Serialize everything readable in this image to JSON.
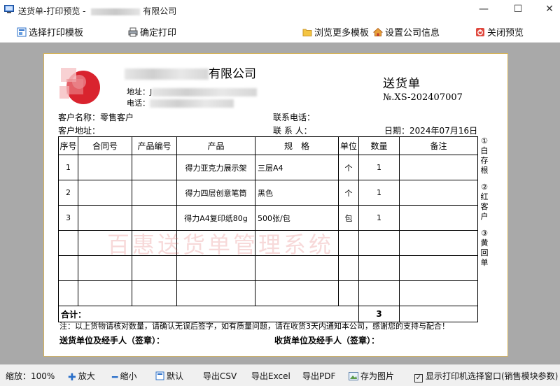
{
  "window": {
    "title_prefix": "送货单-打印预览 - ",
    "title_suffix": "有限公司",
    "minimize": "—",
    "maximize": "☐",
    "close": "✕"
  },
  "toolbar": {
    "select_template": "选择打印模板",
    "confirm_print": "确定打印",
    "browse_templates": "浏览更多模板",
    "company_info": "设置公司信息",
    "close_preview": "关闭预览"
  },
  "doc": {
    "company_suffix": "有限公司",
    "address_label": "地址：",
    "address_value": "J",
    "phone_label": "电话：",
    "title": "送货单",
    "number": "№.XS-202407007",
    "customer_name_label": "客户名称：",
    "customer_name": "零售客户",
    "customer_addr_label": "客户地址：",
    "contact_phone_label": "联系电话：",
    "contact_person_label": "联 系 人：",
    "date_label": "日期：",
    "date": "2024年07月16日",
    "headers": [
      "序号",
      "合同号",
      "产品编号",
      "产品",
      "规　格",
      "单位",
      "数量",
      "备注"
    ],
    "rows": [
      {
        "no": "1",
        "contract": "",
        "code": "",
        "product": "得力亚克力展示架",
        "spec": "三层A4",
        "unit": "个",
        "qty": "1",
        "remark": ""
      },
      {
        "no": "2",
        "contract": "",
        "code": "",
        "product": "得力四层创意笔筒",
        "spec": "黑色",
        "unit": "个",
        "qty": "1",
        "remark": ""
      },
      {
        "no": "3",
        "contract": "",
        "code": "",
        "product": "得力A4复印纸80g",
        "spec": "500张/包",
        "unit": "包",
        "qty": "1",
        "remark": ""
      },
      {
        "no": "",
        "contract": "",
        "code": "",
        "product": "",
        "spec": "",
        "unit": "",
        "qty": "",
        "remark": ""
      },
      {
        "no": "",
        "contract": "",
        "code": "",
        "product": "",
        "spec": "",
        "unit": "",
        "qty": "",
        "remark": ""
      },
      {
        "no": "",
        "contract": "",
        "code": "",
        "product": "",
        "spec": "",
        "unit": "",
        "qty": "",
        "remark": ""
      }
    ],
    "total_label": "合计：",
    "total_qty": "3",
    "copies": [
      "①",
      "白",
      "存",
      "根",
      "②",
      "红",
      "客",
      "户",
      "③",
      "黄",
      "回",
      "单"
    ],
    "watermark": "百惠送货单管理系统",
    "note": "注：以上货物请核对数量，请确认无误后签字，如有质量问题，请在收货3天内通知本公司，感谢您的支持与配合！",
    "sender_sign": "送货单位及经手人（签章）：",
    "receiver_sign": "收货单位及经手人（签章）："
  },
  "statusbar": {
    "zoom_label": "缩放：",
    "zoom_value": "100%",
    "zoom_in": "放大",
    "zoom_out": "缩小",
    "default": "默认",
    "export_csv": "导出CSV",
    "export_excel": "导出Excel",
    "export_pdf": "导出PDF",
    "save_image": "存为图片",
    "show_printer_dialog": "显示打印机选择窗口(销售模块参数)",
    "show_printer_checked": "✓"
  },
  "colors": {
    "preview_bg": "#a9a9a9",
    "paper_border": "#d4b25a",
    "watermark": "#dc5050",
    "logo_red": "#d9232e"
  }
}
